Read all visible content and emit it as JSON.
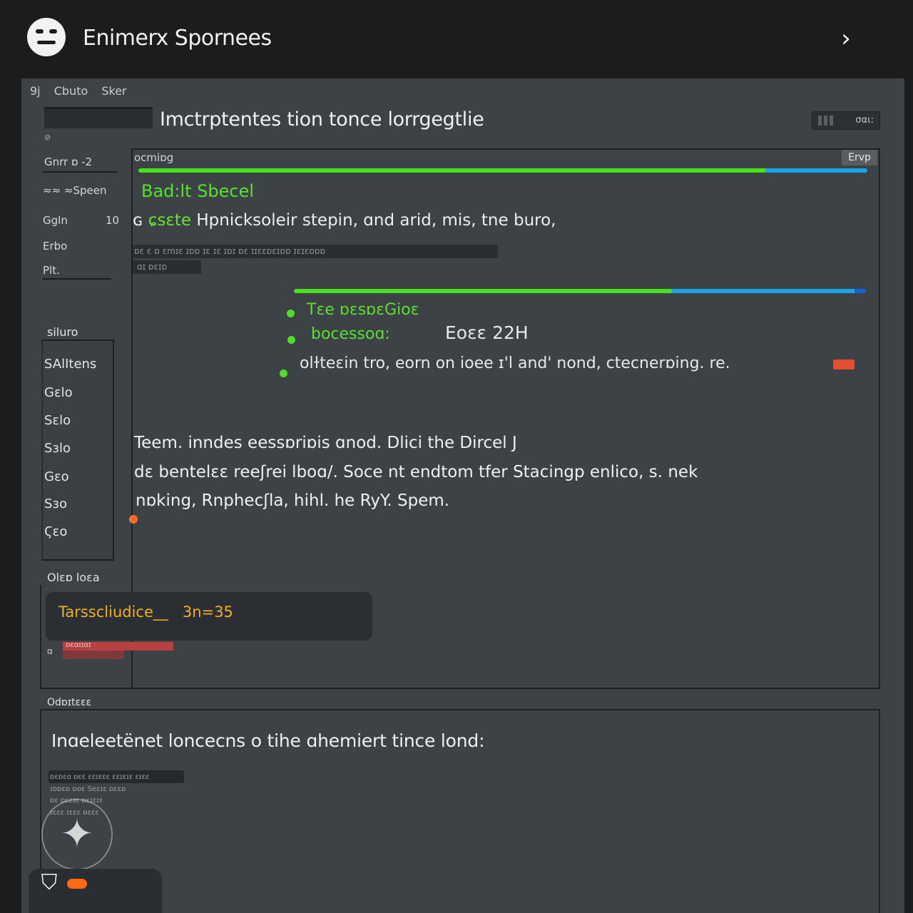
{
  "app": {
    "title": "Enimerx Spornees"
  },
  "breadcrumb": {
    "items": [
      "9j",
      "Cbuto",
      "Sker"
    ]
  },
  "header": {
    "title": "Imctrptentes tion tonce lorrgegtlie",
    "mini_button": "σαι:"
  },
  "left_nav": {
    "items": [
      {
        "label": "Gnrr  ɒ  -2"
      },
      {
        "label": "≈≈ ≈Speen"
      },
      {
        "label": "Ggln",
        "count": "10"
      },
      {
        "label": "Erbo"
      },
      {
        "label": "Plt."
      }
    ],
    "small_mark": "⊘"
  },
  "side_section": {
    "label": "siluro",
    "items": [
      "SAlItens",
      "Gɛlo",
      "Sɛlo",
      "Sɜlo",
      "Gɛo",
      "Sɜo",
      "Ϛɛo"
    ]
  },
  "code": {
    "tab_left": "ocmiɒg",
    "tab_right": "Ervp",
    "progress_top": 0.86,
    "progress_mid": 0.66,
    "green_heading": "Bad:lt Sbecel",
    "line_prefix": "ɢ",
    "line_green": "ɕsɛte",
    "line_text": "Hpnicksoleir stepin, ɑnd arid, mis, tne buro,",
    "dim_row_1": "ɒɛ ɛ ɒ ɛmɪɛ ɪɒɒ ɪɛ ɪɛ ɪɒɪ ɒɛ ɪɪɛɛɒɛɪɒɒ ɪɛɪɛɒɒɒ",
    "dim_row_2": "ɑɪ ɒɛɪɒ"
  },
  "bullets": [
    {
      "text": "Tɛe ɒɛsɒɛGioɛ",
      "green": true
    },
    {
      "text": "bocessoɑ:",
      "green": true,
      "suffix": "Eoɛɛ   22H"
    },
    {
      "text": "olɫteɛin tro, eorn on ioee  ɪ'l and'  nond, ctecnerɒing. re.",
      "green": false
    }
  ],
  "paragraph": {
    "line_1": "Teem. inndes eessɒriɒis ɑnod. Dlici the Dircel J",
    "line_2": "dɛ bentelɛɛ reeʃrei lboɑ/. Soce nt  endtom  tfer Stacingp enlico,    s.  nek",
    "line_3": "nɒking, Rnphecʃla,  hihl. he RyY. Spem."
  },
  "inner": {
    "label": "Olɛɒ loɛa",
    "terminal_label": "Tarsscliudice__",
    "terminal_value": "3n=35",
    "small_a": "ɑ",
    "red_bar_text": "ɒɛɑɪɪɑɪ"
  },
  "bottom": {
    "label": "Odɒɪtɛɛɛ",
    "heading": "Inɑeleetënet loncecns o   tihe ɑhemiert tince lond:",
    "meta": [
      "ɒɛɒɛɑ ɒɛɛ ɛɛɪɛɛɛ ɛɛɪɛɪɛ ɛɪɛɛ",
      "ɪɒɒɛɒ ɒɒɛ Seɛɪɛ ɒɛɛɒ",
      "ɒɛ ɒɛɛɪɛ ɒɛɪɛɪɛ",
      "ɪɛɛɛ ɪɛɛɛ ɒɛɛɛ"
    ]
  },
  "colors": {
    "accent_green": "#49e11d",
    "accent_blue": "#1aa6e6",
    "warning_orange": "#ff6a2a",
    "terminal_amber": "#f0b020"
  },
  "icons": {
    "app_logo": "smiley-icon",
    "header_chevron": "chevron-right-icon",
    "badge": "sparkle-star-icon",
    "bottom_pill": "shield-icon"
  }
}
